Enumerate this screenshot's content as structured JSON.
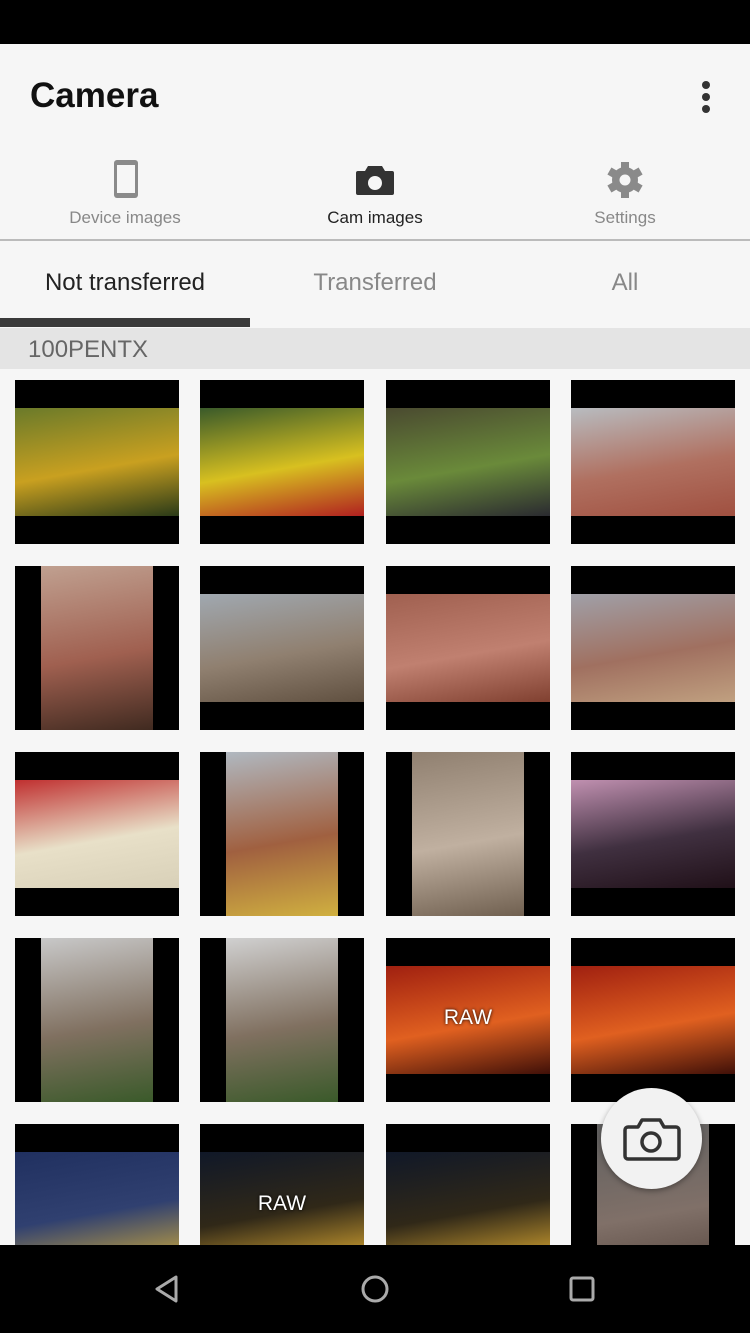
{
  "app": {
    "title": "Camera",
    "more_icon": "more-vert-icon"
  },
  "nav_tabs": [
    {
      "label": "Device images",
      "icon": "smartphone-icon",
      "active": false
    },
    {
      "label": "Cam images",
      "icon": "camera-icon",
      "active": true
    },
    {
      "label": "Settings",
      "icon": "gear-icon",
      "active": false
    }
  ],
  "sub_tabs": [
    {
      "label": "Not transferred",
      "active": true
    },
    {
      "label": "Transferred",
      "active": false
    },
    {
      "label": "All",
      "active": false
    }
  ],
  "folder": "100PENTX",
  "thumbnails": [
    {
      "orientation": "land",
      "colors": [
        "#6a7a2a",
        "#c9a020",
        "#2a3a18"
      ],
      "badge": ""
    },
    {
      "orientation": "land",
      "colors": [
        "#3a5a2a",
        "#d8c020",
        "#b02020"
      ],
      "badge": ""
    },
    {
      "orientation": "land",
      "colors": [
        "#4a4a30",
        "#6a8a3a",
        "#2a2a30"
      ],
      "badge": ""
    },
    {
      "orientation": "land",
      "colors": [
        "#b8bcc0",
        "#b07060",
        "#a05040"
      ],
      "badge": ""
    },
    {
      "orientation": "port",
      "colors": [
        "#c0a090",
        "#a06050",
        "#402a20"
      ],
      "badge": ""
    },
    {
      "orientation": "land",
      "colors": [
        "#a0a8b0",
        "#908070",
        "#605040"
      ],
      "badge": ""
    },
    {
      "orientation": "land",
      "colors": [
        "#a06050",
        "#c08070",
        "#804030"
      ],
      "badge": ""
    },
    {
      "orientation": "land",
      "colors": [
        "#a0a0a8",
        "#a07060",
        "#c0a080"
      ],
      "badge": ""
    },
    {
      "orientation": "land",
      "colors": [
        "#c03030",
        "#e8e0c8",
        "#d8d0b8"
      ],
      "badge": ""
    },
    {
      "orientation": "port",
      "colors": [
        "#b0b8c0",
        "#a06040",
        "#d0b040"
      ],
      "badge": ""
    },
    {
      "orientation": "port",
      "colors": [
        "#908070",
        "#c0b0a0",
        "#706050"
      ],
      "badge": ""
    },
    {
      "orientation": "land",
      "colors": [
        "#c090b0",
        "#403040",
        "#201018"
      ],
      "badge": ""
    },
    {
      "orientation": "port",
      "colors": [
        "#c8c8c8",
        "#807060",
        "#3a5a2a"
      ],
      "badge": ""
    },
    {
      "orientation": "port",
      "colors": [
        "#d0d0d0",
        "#807060",
        "#3a5a2a"
      ],
      "badge": ""
    },
    {
      "orientation": "land",
      "colors": [
        "#a02010",
        "#e06020",
        "#401008"
      ],
      "badge": "RAW"
    },
    {
      "orientation": "land",
      "colors": [
        "#a02010",
        "#e06020",
        "#401008"
      ],
      "badge": ""
    },
    {
      "orientation": "land",
      "colors": [
        "#203060",
        "#304070",
        "#c0a040"
      ],
      "badge": ""
    },
    {
      "orientation": "land",
      "colors": [
        "#101828",
        "#302818",
        "#d0a030"
      ],
      "badge": "RAW"
    },
    {
      "orientation": "land",
      "colors": [
        "#101828",
        "#302818",
        "#d0a030"
      ],
      "badge": ""
    },
    {
      "orientation": "port",
      "colors": [
        "#606060",
        "#807068",
        "#504038"
      ],
      "badge": ""
    }
  ],
  "fab": {
    "icon": "camera-outline-icon"
  },
  "system_nav": [
    "back-icon",
    "home-icon",
    "recents-icon"
  ]
}
